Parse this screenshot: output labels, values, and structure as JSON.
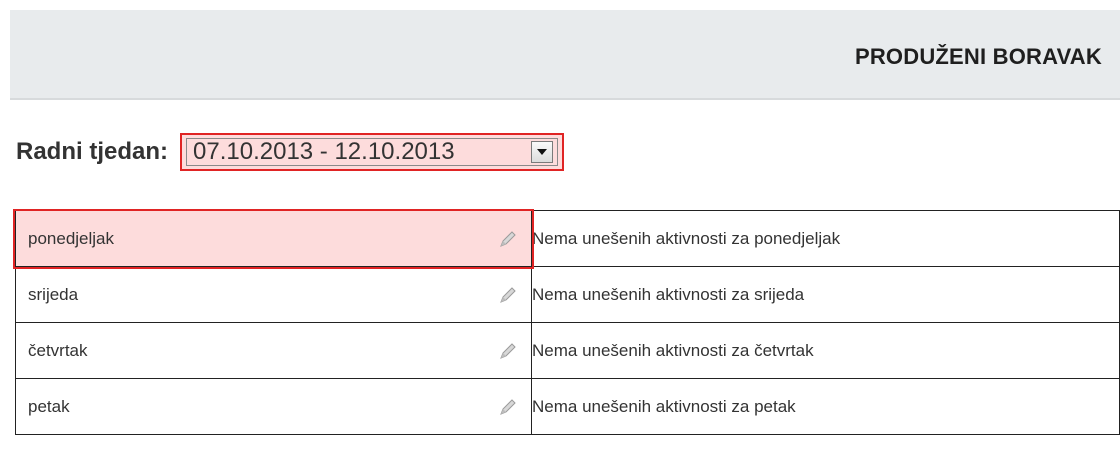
{
  "header": {
    "title": "PRODUŽENI BORAVAK"
  },
  "week": {
    "label": "Radni tjedan:",
    "selected_value": "07.10.2013 - 12.10.2013"
  },
  "icons": {
    "edit": "pencil-icon",
    "dropdown": "chevron-down-icon"
  },
  "colors": {
    "highlight_fill": "#fddcdc",
    "highlight_border": "#e02424",
    "header_bg": "#e8ebed"
  },
  "days": [
    {
      "name": "ponedjeljak",
      "description": "Nema unešenih aktivnosti za ponedjeljak"
    },
    {
      "name": "srijeda",
      "description": "Nema unešenih aktivnosti za srijeda"
    },
    {
      "name": "četvrtak",
      "description": "Nema unešenih aktivnosti za četvrtak"
    },
    {
      "name": "petak",
      "description": "Nema unešenih aktivnosti za petak"
    }
  ]
}
